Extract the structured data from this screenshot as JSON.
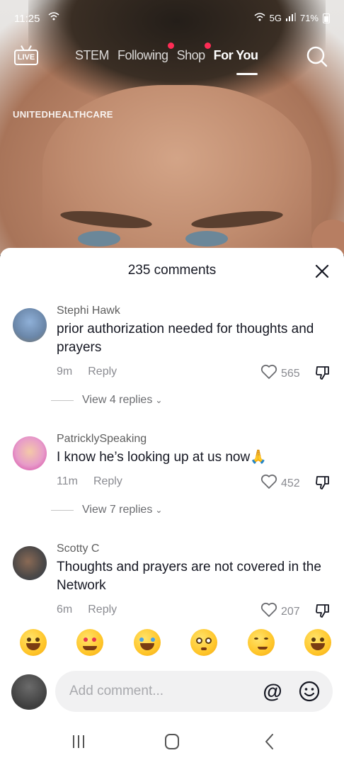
{
  "status_bar": {
    "time": "11:25",
    "network": "5G",
    "battery": "71%"
  },
  "top_nav": {
    "live_label": "LIVE",
    "tabs": [
      {
        "label": "STEM",
        "active": false,
        "has_dot": false
      },
      {
        "label": "Following",
        "active": false,
        "has_dot": true
      },
      {
        "label": "Shop",
        "active": false,
        "has_dot": true
      },
      {
        "label": "For You",
        "active": true,
        "has_dot": false
      }
    ]
  },
  "video": {
    "sponsor_label": "UNITEDHEALTHCARE"
  },
  "comments_sheet": {
    "title": "235 comments",
    "comments": [
      {
        "username": "Stephi Hawk",
        "text": "prior authorization needed for thoughts and prayers",
        "time": "9m",
        "reply_label": "Reply",
        "likes": "565",
        "view_replies": "View 4 replies"
      },
      {
        "username": "PatricklySpeaking",
        "text": "I know he’s looking up at us now🙏",
        "time": "11m",
        "reply_label": "Reply",
        "likes": "452",
        "view_replies": "View 7 replies"
      },
      {
        "username": "Scotty C",
        "text": "Thoughts and prayers are not covered in the Network",
        "time": "6m",
        "reply_label": "Reply",
        "likes": "207"
      }
    ],
    "emoji_bar": [
      "grinning-face",
      "smiling-face-with-hearts",
      "face-with-tears-of-joy",
      "flushed-face",
      "smirking-face",
      "grinning-face-with-sweat"
    ],
    "input": {
      "placeholder": "Add comment..."
    }
  },
  "colors": {
    "accent_red": "#fe2c55",
    "text_primary": "#161823",
    "text_secondary": "#8a8b91"
  }
}
